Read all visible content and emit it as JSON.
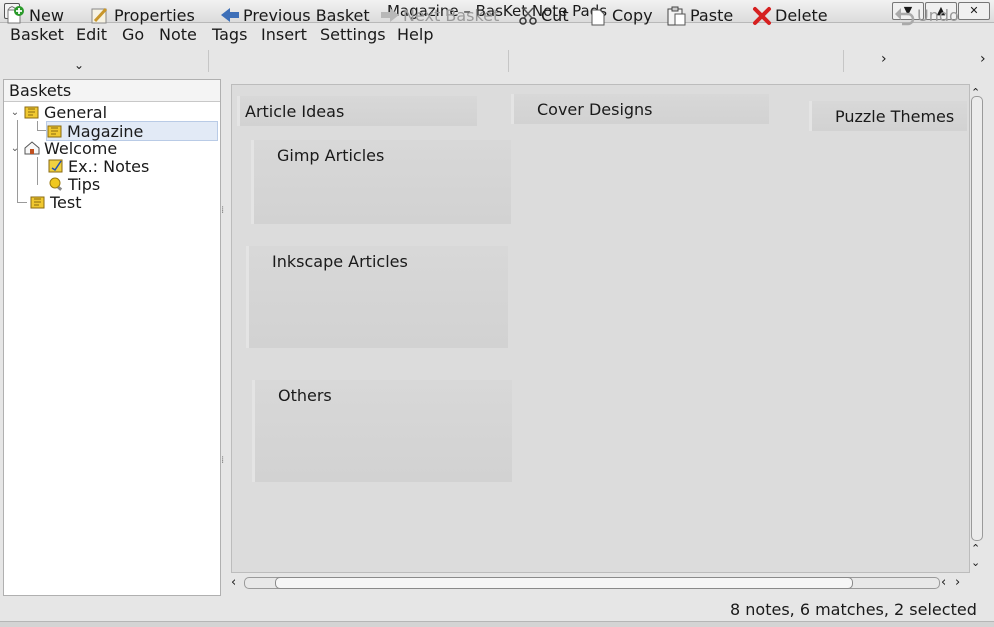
{
  "window": {
    "title": "Magazine – BasKet Note Pads"
  },
  "menubar": [
    "Basket",
    "Edit",
    "Go",
    "Note",
    "Tags",
    "Insert",
    "Settings",
    "Help"
  ],
  "toolbar": {
    "new_label": "New",
    "properties_label": "Properties",
    "previous_label": "Previous Basket",
    "next_label": "Next Basket",
    "cut_label": "Cut",
    "copy_label": "Copy",
    "paste_label": "Paste",
    "delete_label": "Delete",
    "undo_label": "Undo",
    "overflow_left": "›",
    "overflow_right": "›"
  },
  "sidebar": {
    "header": "Baskets",
    "items": [
      {
        "label": "General",
        "level": 0,
        "icon": "basket-icon",
        "expanded": true
      },
      {
        "label": "Magazine",
        "level": 1,
        "icon": "basket-icon",
        "selected": true
      },
      {
        "label": "Welcome",
        "level": 0,
        "icon": "home-icon",
        "expanded": true
      },
      {
        "label": "Ex.: Notes",
        "level": 1,
        "icon": "notes-icon"
      },
      {
        "label": "Tips",
        "level": 1,
        "icon": "bulb-icon"
      },
      {
        "label": "Test",
        "level": 0,
        "icon": "basket-icon"
      }
    ]
  },
  "notes": [
    {
      "title": "Article Ideas"
    },
    {
      "title": "Cover Designs"
    },
    {
      "title": "Puzzle Themes"
    },
    {
      "title": "Gimp Articles"
    },
    {
      "title": "Inkscape Articles"
    },
    {
      "title": "Others"
    }
  ],
  "status": "8 notes, 6 matches, 2 selected",
  "colors": {
    "content_bg": "#dcdcdc",
    "note_bg": "#d6d6d6",
    "selection": "#e2eaf6",
    "delete_red": "#d62020",
    "arrow_blue": "#3d6fb8"
  }
}
